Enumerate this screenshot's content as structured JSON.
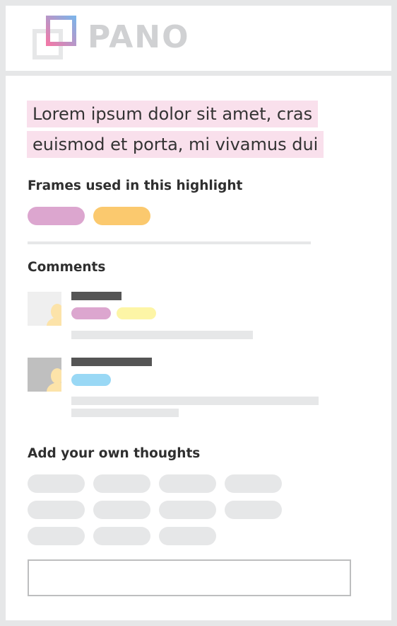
{
  "app": {
    "logo_text": "PANO",
    "logo_colors": {
      "front_square": "gradient-pink-blue",
      "back_square": "#e6e7e8"
    }
  },
  "highlight": {
    "lines": [
      "Lorem ipsum dolor sit amet, cras",
      "euismod et porta, mi vivamus dui"
    ],
    "background": "#f9e0ec"
  },
  "frames": {
    "heading": "Frames used in this highlight",
    "colors": [
      "#dca6cf",
      "#fbc96e"
    ]
  },
  "comments": {
    "heading": "Comments",
    "items": [
      {
        "avatar_icon": "user-avatar-icon",
        "tag_colors": [
          "#dca6cf",
          "#fdf5a6"
        ],
        "text_lines": 1
      },
      {
        "avatar_icon": "user-avatar-icon",
        "tag_colors": [
          "#99d8f5"
        ],
        "text_lines": 2
      }
    ]
  },
  "thoughts": {
    "heading": "Add your own thoughts",
    "option_count": 11,
    "input_value": ""
  }
}
